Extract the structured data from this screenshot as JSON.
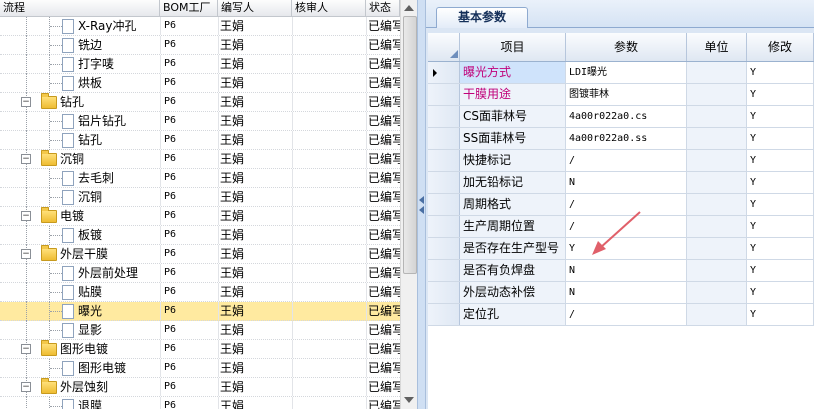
{
  "tree_grid": {
    "columns": [
      "流程",
      "BOM工厂",
      "编写人",
      "核审人",
      "状态"
    ],
    "rows": [
      {
        "level": 2,
        "type": "doc",
        "label": "X-Ray冲孔",
        "bom": "P6",
        "writer": "王娟",
        "reviewer": "",
        "status": "已编写",
        "selected": false
      },
      {
        "level": 2,
        "type": "doc",
        "label": "铣边",
        "bom": "P6",
        "writer": "王娟",
        "reviewer": "",
        "status": "已编写",
        "selected": false
      },
      {
        "level": 2,
        "type": "doc",
        "label": "打字唛",
        "bom": "P6",
        "writer": "王娟",
        "reviewer": "",
        "status": "已编写",
        "selected": false
      },
      {
        "level": 2,
        "type": "doc",
        "label": "烘板",
        "bom": "P6",
        "writer": "王娟",
        "reviewer": "",
        "status": "已编写",
        "selected": false
      },
      {
        "level": 1,
        "type": "folder",
        "label": "钻孔",
        "bom": "P6",
        "writer": "王娟",
        "reviewer": "",
        "status": "已编写",
        "selected": false
      },
      {
        "level": 2,
        "type": "doc",
        "label": "铝片钻孔",
        "bom": "P6",
        "writer": "王娟",
        "reviewer": "",
        "status": "已编写",
        "selected": false
      },
      {
        "level": 2,
        "type": "doc",
        "label": "钻孔",
        "bom": "P6",
        "writer": "王娟",
        "reviewer": "",
        "status": "已编写",
        "selected": false
      },
      {
        "level": 1,
        "type": "folder",
        "label": "沉铜",
        "bom": "P6",
        "writer": "王娟",
        "reviewer": "",
        "status": "已编写",
        "selected": false
      },
      {
        "level": 2,
        "type": "doc",
        "label": "去毛刺",
        "bom": "P6",
        "writer": "王娟",
        "reviewer": "",
        "status": "已编写",
        "selected": false
      },
      {
        "level": 2,
        "type": "doc",
        "label": "沉铜",
        "bom": "P6",
        "writer": "王娟",
        "reviewer": "",
        "status": "已编写",
        "selected": false
      },
      {
        "level": 1,
        "type": "folder",
        "label": "电镀",
        "bom": "P6",
        "writer": "王娟",
        "reviewer": "",
        "status": "已编写",
        "selected": false
      },
      {
        "level": 2,
        "type": "doc",
        "label": "板镀",
        "bom": "P6",
        "writer": "王娟",
        "reviewer": "",
        "status": "已编写",
        "selected": false
      },
      {
        "level": 1,
        "type": "folder",
        "label": "外层干膜",
        "bom": "P6",
        "writer": "王娟",
        "reviewer": "",
        "status": "已编写",
        "selected": false
      },
      {
        "level": 2,
        "type": "doc",
        "label": "外层前处理",
        "bom": "P6",
        "writer": "王娟",
        "reviewer": "",
        "status": "已编写",
        "selected": false
      },
      {
        "level": 2,
        "type": "doc",
        "label": "贴膜",
        "bom": "P6",
        "writer": "王娟",
        "reviewer": "",
        "status": "已编写",
        "selected": false
      },
      {
        "level": 2,
        "type": "doc",
        "label": "曝光",
        "bom": "P6",
        "writer": "王娟",
        "reviewer": "",
        "status": "已编写",
        "selected": true
      },
      {
        "level": 2,
        "type": "doc",
        "label": "显影",
        "bom": "P6",
        "writer": "王娟",
        "reviewer": "",
        "status": "已编写",
        "selected": false
      },
      {
        "level": 1,
        "type": "folder",
        "label": "图形电镀",
        "bom": "P6",
        "writer": "王娟",
        "reviewer": "",
        "status": "已编写",
        "selected": false
      },
      {
        "level": 2,
        "type": "doc",
        "label": "图形电镀",
        "bom": "P6",
        "writer": "王娟",
        "reviewer": "",
        "status": "已编写",
        "selected": false
      },
      {
        "level": 1,
        "type": "folder",
        "label": "外层蚀刻",
        "bom": "P6",
        "writer": "王娟",
        "reviewer": "",
        "status": "已编写",
        "selected": false
      },
      {
        "level": 2,
        "type": "doc",
        "label": "退膜",
        "bom": "P6",
        "writer": "王娟",
        "reviewer": "",
        "status": "已编写",
        "selected": false
      }
    ]
  },
  "params_panel": {
    "tab_label": "基本参数",
    "columns": [
      "项目",
      "参数",
      "单位",
      "修改"
    ],
    "rows": [
      {
        "item": "曝光方式",
        "value": "LDI曝光",
        "unit": "",
        "modify": "Y",
        "highlight": true,
        "current": true
      },
      {
        "item": "干膜用途",
        "value": "图镀菲林",
        "unit": "",
        "modify": "Y",
        "highlight": true,
        "current": false
      },
      {
        "item": "CS面菲林号",
        "value": "4a00r022a0.cs",
        "unit": "",
        "modify": "Y",
        "highlight": false,
        "current": false
      },
      {
        "item": "SS面菲林号",
        "value": "4a00r022a0.ss",
        "unit": "",
        "modify": "Y",
        "highlight": false,
        "current": false
      },
      {
        "item": "快捷标记",
        "value": "/",
        "unit": "",
        "modify": "Y",
        "highlight": false,
        "current": false
      },
      {
        "item": "加无铅标记",
        "value": "N",
        "unit": "",
        "modify": "Y",
        "highlight": false,
        "current": false
      },
      {
        "item": "周期格式",
        "value": "/",
        "unit": "",
        "modify": "Y",
        "highlight": false,
        "current": false
      },
      {
        "item": "生产周期位置",
        "value": "/",
        "unit": "",
        "modify": "Y",
        "highlight": false,
        "current": false
      },
      {
        "item": "是否存在生产型号",
        "value": "Y",
        "unit": "",
        "modify": "Y",
        "highlight": false,
        "current": false
      },
      {
        "item": "是否有负焊盘",
        "value": "N",
        "unit": "",
        "modify": "Y",
        "highlight": false,
        "current": false
      },
      {
        "item": "外层动态补偿",
        "value": "N",
        "unit": "",
        "modify": "Y",
        "highlight": false,
        "current": false
      },
      {
        "item": "定位孔",
        "value": "/",
        "unit": "",
        "modify": "Y",
        "highlight": false,
        "current": false
      }
    ]
  },
  "colors": {
    "selected_row": "#ffeaa0",
    "highlight_text": "#c0007a",
    "annotation_arrow": "#e0606a",
    "panel_background": "#dbe6f4"
  }
}
